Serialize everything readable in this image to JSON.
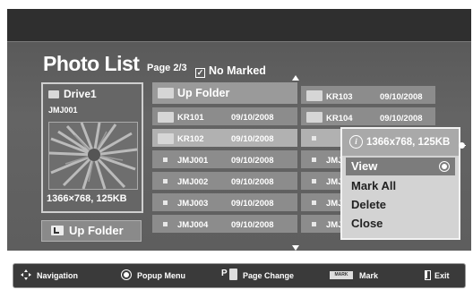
{
  "header": {
    "title": "Photo List",
    "page": "Page 2/3",
    "marked": "No Marked"
  },
  "drive": {
    "name": "Drive1",
    "sub": "JMJ001",
    "resolution": "1366×768, 125KB"
  },
  "up_folder_button": "Up Folder",
  "grid": {
    "up_folder": "Up Folder",
    "left": [
      {
        "name": "KR101",
        "date": "09/10/2008",
        "type": "folder"
      },
      {
        "name": "KR102",
        "date": "09/10/2008",
        "type": "folder"
      },
      {
        "name": "JMJ001",
        "date": "09/10/2008",
        "type": "photo"
      },
      {
        "name": "JMJ002",
        "date": "09/10/2008",
        "type": "photo"
      },
      {
        "name": "JMJ003",
        "date": "09/10/2008",
        "type": "photo"
      },
      {
        "name": "JMJ004",
        "date": "09/10/2008",
        "type": "photo"
      }
    ],
    "right": [
      {
        "name": "KR103",
        "date": "09/10/2008",
        "type": "folder"
      },
      {
        "name": "KR104",
        "date": "09/10/2008",
        "type": "folder"
      },
      {
        "name": "",
        "date": "",
        "type": "photo"
      },
      {
        "name": "JMJ",
        "date": "",
        "type": "photo"
      },
      {
        "name": "JMJ",
        "date": "",
        "type": "photo"
      },
      {
        "name": "JMJ",
        "date": "",
        "type": "photo"
      },
      {
        "name": "JMJ",
        "date": "",
        "type": "photo"
      }
    ]
  },
  "popup": {
    "info": "1366x768, 125KB",
    "items": [
      "View",
      "Mark All",
      "Delete",
      "Close"
    ],
    "selected_index": 0
  },
  "footer": {
    "navigation": "Navigation",
    "popup_menu": "Popup Menu",
    "page_change": "Page Change",
    "mark": "Mark",
    "mark_key": "MARK",
    "exit": "Exit",
    "p_key": "P"
  },
  "colors": {
    "panel": "#5e5e5e",
    "highlight": "#b1b1b1",
    "popup_bg": "#d3d3d3",
    "selected": "#7c7c7c"
  }
}
